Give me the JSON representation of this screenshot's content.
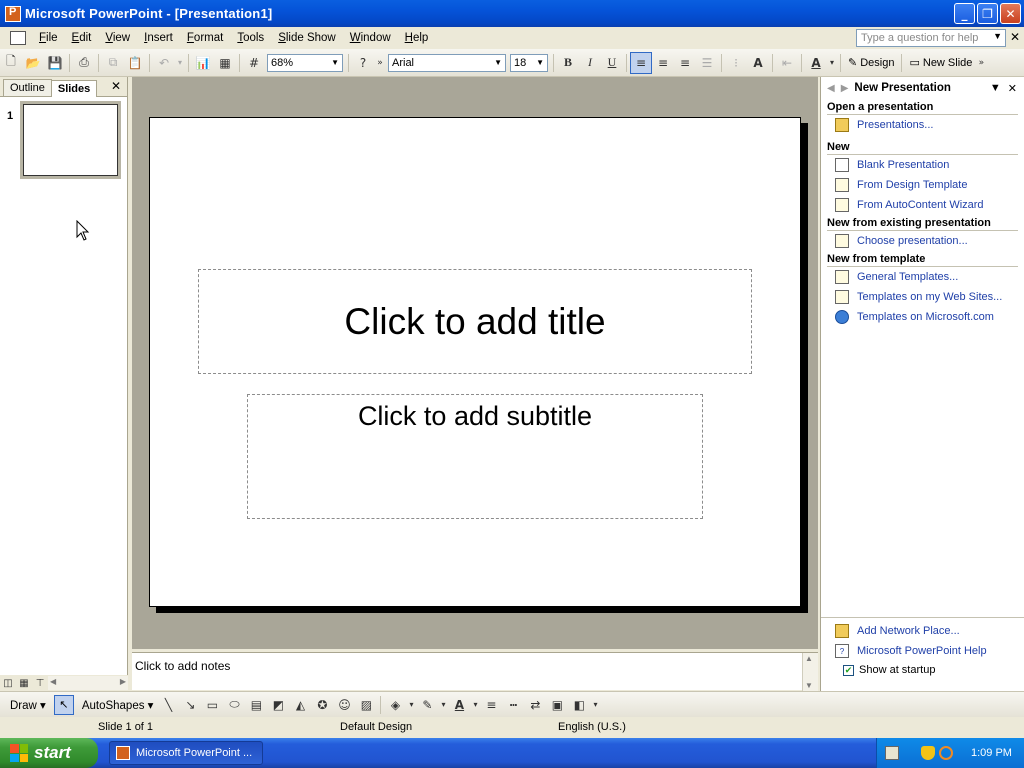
{
  "window": {
    "title": "Microsoft PowerPoint - [Presentation1]"
  },
  "menu": {
    "items": [
      "File",
      "Edit",
      "View",
      "Insert",
      "Format",
      "Tools",
      "Slide Show",
      "Window",
      "Help"
    ],
    "help_placeholder": "Type a question for help"
  },
  "toolbar": {
    "zoom": "68%",
    "font": "Arial",
    "font_size": "18",
    "bold": "B",
    "italic": "I",
    "underline": "U",
    "design_label": "Design",
    "new_slide_label": "New Slide"
  },
  "left_pane": {
    "tab_outline": "Outline",
    "tab_slides": "Slides",
    "slide_number": "1"
  },
  "slide": {
    "title_placeholder": "Click to add title",
    "subtitle_placeholder": "Click to add subtitle"
  },
  "notes": {
    "placeholder": "Click to add notes"
  },
  "task_pane": {
    "title": "New Presentation",
    "sections": {
      "open": "Open a presentation",
      "new": "New",
      "existing": "New from existing presentation",
      "template": "New from template"
    },
    "links": {
      "presentations": "Presentations...",
      "blank": "Blank Presentation",
      "design_template": "From Design Template",
      "autocontent": "From AutoContent Wizard",
      "choose": "Choose presentation...",
      "general_templates": "General Templates...",
      "web_sites": "Templates on my Web Sites...",
      "microsoft_com": "Templates on Microsoft.com",
      "network_place": "Add Network Place...",
      "help": "Microsoft PowerPoint Help"
    },
    "show_at_startup": "Show at startup"
  },
  "draw_toolbar": {
    "draw": "Draw",
    "autoshapes": "AutoShapes"
  },
  "status": {
    "slide": "Slide 1 of 1",
    "design": "Default Design",
    "language": "English (U.S.)"
  },
  "taskbar": {
    "start": "start",
    "app_button": "Microsoft PowerPoint ...",
    "clock": "1:09 PM"
  }
}
